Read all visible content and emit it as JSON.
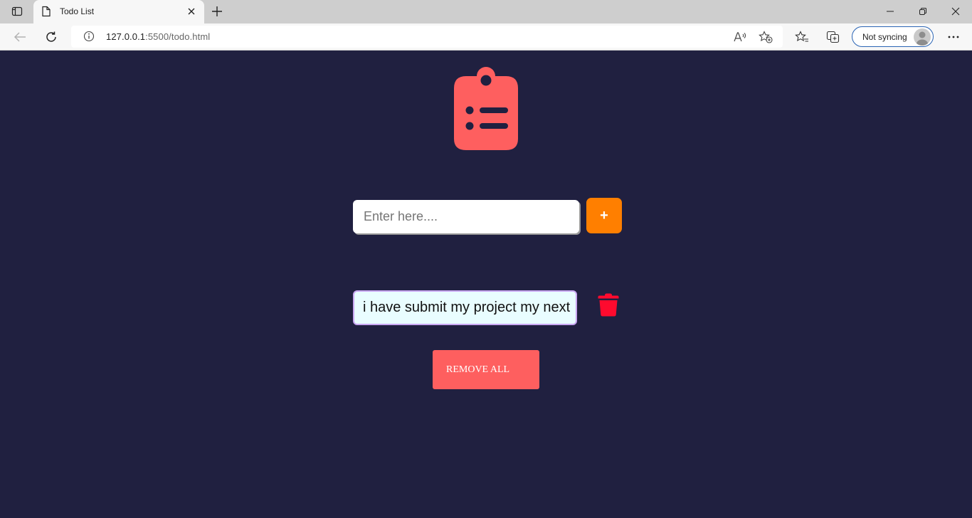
{
  "browser": {
    "tab": {
      "title": "Todo List"
    },
    "address": {
      "host": "127.0.0.1",
      "rest": ":5500/todo.html"
    },
    "profile": {
      "label": "Not syncing"
    }
  },
  "app": {
    "logo_icon": "clipboard-list-icon",
    "input": {
      "placeholder": "Enter here....",
      "value": ""
    },
    "add_button": {
      "label": "+"
    },
    "todos": [
      {
        "text": "i have submit my project my next"
      }
    ],
    "delete_icon": "trash-icon",
    "remove_all": {
      "label": "REMOVE ALL"
    }
  },
  "colors": {
    "background": "#202040",
    "accent_coral": "#fe5f5f",
    "add_button": "#ff7f00",
    "delete_icon": "#ff0a2e",
    "todo_item_bg": "#e9fdff",
    "todo_item_border": "#c9a7f2"
  }
}
